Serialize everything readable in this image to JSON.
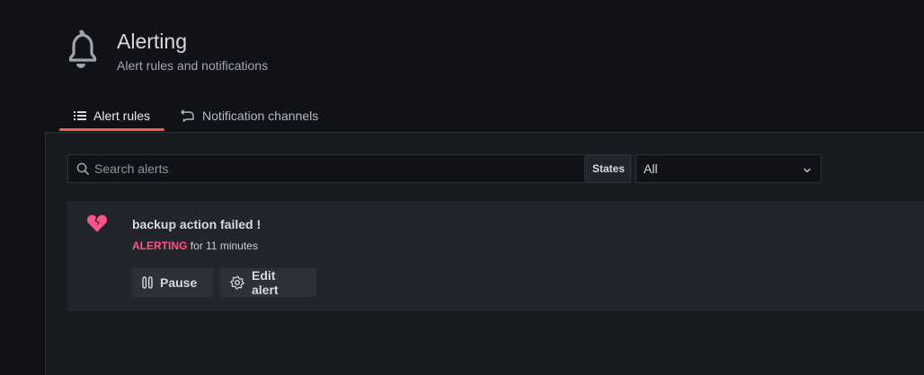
{
  "page": {
    "title": "Alerting",
    "subtitle": "Alert rules and notifications",
    "icon": "bell-icon"
  },
  "tabs": [
    {
      "label": "Alert rules",
      "icon": "list-icon",
      "active": true
    },
    {
      "label": "Notification channels",
      "icon": "comment-alt-share-icon",
      "active": false
    }
  ],
  "filters": {
    "search_placeholder": "Search alerts",
    "search_value": "",
    "states_label": "States",
    "states_selected": "All"
  },
  "alerts": [
    {
      "name": "backup action failed !",
      "state": "ALERTING",
      "state_suffix": "for 11 minutes",
      "state_color": "#ff5286",
      "icon": "heart-break-icon",
      "actions": {
        "pause_label": "Pause",
        "edit_label": "Edit alert"
      }
    }
  ],
  "colors": {
    "accent": "#f55f3e",
    "alerting": "#ff5286",
    "background": "#111217"
  }
}
